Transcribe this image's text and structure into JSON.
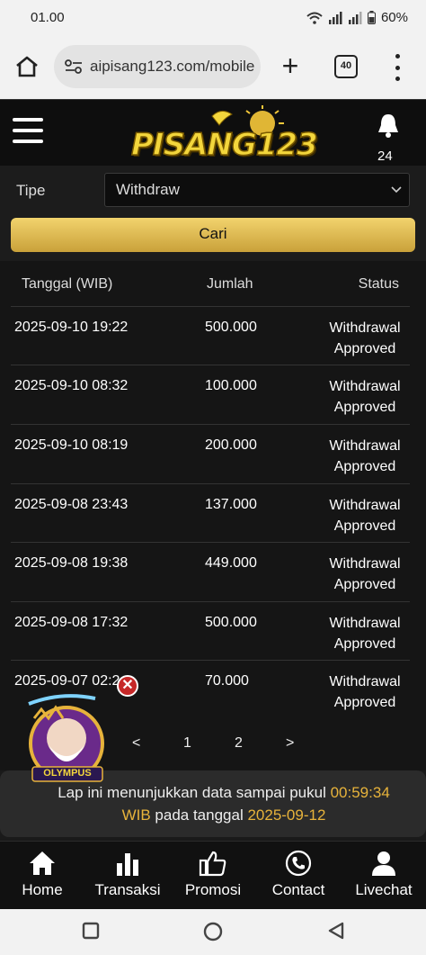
{
  "status_bar": {
    "time": "01.00",
    "battery": "60%"
  },
  "browser": {
    "url": "aipisang123.com/mobile",
    "tab_count": "40",
    "new_tab_glyph": "+"
  },
  "header": {
    "logo_text": "PISANG123",
    "notification_count": "24"
  },
  "filter": {
    "type_label": "Tipe",
    "type_value": "Withdraw",
    "search_button": "Cari"
  },
  "table": {
    "columns": [
      "Tanggal (WIB)",
      "Jumlah",
      "Status"
    ],
    "rows": [
      {
        "date": "2025-09-10 19:22",
        "amount": "500.000",
        "status_line1": "Withdrawal",
        "status_line2": "Approved"
      },
      {
        "date": "2025-09-10 08:32",
        "amount": "100.000",
        "status_line1": "Withdrawal",
        "status_line2": "Approved"
      },
      {
        "date": "2025-09-10 08:19",
        "amount": "200.000",
        "status_line1": "Withdrawal",
        "status_line2": "Approved"
      },
      {
        "date": "2025-09-08 23:43",
        "amount": "137.000",
        "status_line1": "Withdrawal",
        "status_line2": "Approved"
      },
      {
        "date": "2025-09-08 19:38",
        "amount": "449.000",
        "status_line1": "Withdrawal",
        "status_line2": "Approved"
      },
      {
        "date": "2025-09-08 17:32",
        "amount": "500.000",
        "status_line1": "Withdrawal",
        "status_line2": "Approved"
      },
      {
        "date": "2025-09-07 02:2",
        "amount": "70.000",
        "status_line1": "Withdrawal",
        "status_line2": "Approved"
      }
    ]
  },
  "pagination": {
    "prev": "<",
    "pages": [
      "1",
      "2"
    ],
    "next": ">"
  },
  "promo": {
    "badge_text": "OLYMPUS",
    "close_glyph": "✕"
  },
  "note": {
    "prefix": "Lap",
    "text1": " ini menunjukkan data sampai pukul ",
    "time": "00:59:34",
    "tz": "WIB",
    "text2": " pada tanggal ",
    "date": "2025-09-12"
  },
  "bottom_nav": [
    {
      "label": "Home",
      "icon": "home-icon"
    },
    {
      "label": "Transaksi",
      "icon": "bar-chart-icon"
    },
    {
      "label": "Promosi",
      "icon": "thumbs-up-icon"
    },
    {
      "label": "Contact",
      "icon": "phone-icon"
    },
    {
      "label": "Livechat",
      "icon": "person-icon"
    }
  ],
  "colors": {
    "accent": "#e7b33b",
    "button_gold": "#d9b14a",
    "background": "#151515"
  }
}
